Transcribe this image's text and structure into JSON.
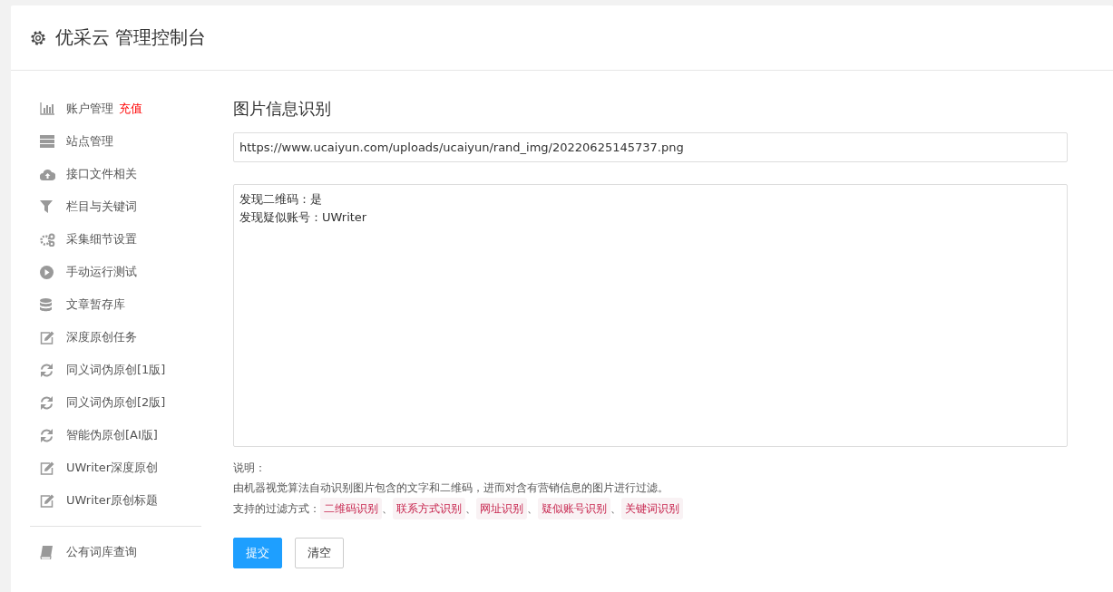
{
  "header": {
    "title": "优采云 管理控制台"
  },
  "sidebar": {
    "items": [
      {
        "kind": "link",
        "label": "账户管理",
        "badge": "充值"
      },
      {
        "kind": "link",
        "label": "站点管理"
      },
      {
        "kind": "link",
        "label": "接口文件相关"
      },
      {
        "kind": "link",
        "label": "栏目与关键词"
      },
      {
        "kind": "link",
        "label": "采集细节设置"
      },
      {
        "kind": "link",
        "label": "手动运行测试"
      },
      {
        "kind": "link",
        "label": "文章暂存库"
      },
      {
        "kind": "link",
        "label": "深度原创任务"
      },
      {
        "kind": "link",
        "label": "同义词伪原创[1版]"
      },
      {
        "kind": "link",
        "label": "同义词伪原创[2版]"
      },
      {
        "kind": "link",
        "label": "智能伪原创[AI版]"
      },
      {
        "kind": "link",
        "label": "UWriter深度原创"
      },
      {
        "kind": "link",
        "label": "UWriter原创标题"
      },
      {
        "kind": "divider"
      },
      {
        "kind": "link",
        "label": "公有词库查询"
      }
    ]
  },
  "main": {
    "heading": "图片信息识别",
    "url_field": {
      "value": "https://www.ucaiyun.com/uploads/ucaiyun/rand_img/20220625145737.png"
    },
    "result_lines": [
      "发现二维码：是",
      "发现疑似账号：UWriter"
    ],
    "note_title": "说明：",
    "note_text": "由机器视觉算法自动识别图片包含的文字和二维码，进而对含有营销信息的图片进行过滤。",
    "methods_label": "支持的过滤方式：",
    "methods": [
      "二维码识别",
      "联系方式识别",
      "网址识别",
      "疑似账号识别",
      "关键词识别"
    ],
    "separator": "、",
    "buttons": [
      {
        "label": "提交",
        "kind": "primary"
      },
      {
        "label": "清空",
        "kind": "default"
      }
    ]
  }
}
